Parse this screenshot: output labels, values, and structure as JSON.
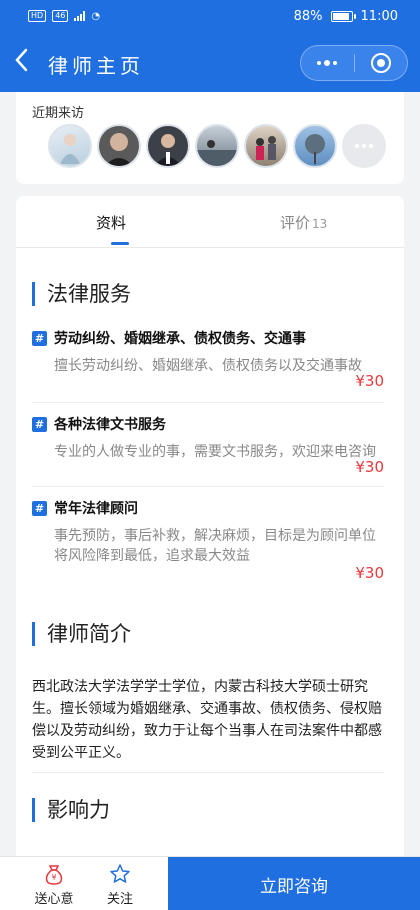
{
  "status_bar": {
    "left_badges": [
      "HD",
      "46"
    ],
    "battery_percent": "88%",
    "time": "11:00"
  },
  "navbar": {
    "back_icon": "chevron-left-icon",
    "title": "律师主页",
    "menu_icon": "more-dots-icon",
    "close_icon": "target-circle-icon"
  },
  "visitors": {
    "label": "近期来访",
    "avatars": [
      {
        "id": "visitor-1",
        "color": "#c9dbe8"
      },
      {
        "id": "visitor-2",
        "color": "#4a4a4a"
      },
      {
        "id": "visitor-3",
        "color": "#2f3338"
      },
      {
        "id": "visitor-4",
        "color": "#8a9aa6"
      },
      {
        "id": "visitor-5",
        "color": "#b7a99a"
      },
      {
        "id": "visitor-6",
        "color": "#7fa6cf"
      }
    ],
    "more_icon": "more-dots-icon"
  },
  "tabs": {
    "info": "资料",
    "reviews": "评价",
    "reviews_count": "13"
  },
  "services": {
    "heading": "法律服务",
    "items": [
      {
        "title": "劳动纠纷、婚姻继承、债权债务、交通事",
        "desc": "擅长劳动纠纷、婚姻继承、债权债务以及交通事故",
        "price": "¥30"
      },
      {
        "title": "各种法律文书服务",
        "desc": "专业的人做专业的事，需要文书服务，欢迎来电咨询",
        "price": "¥30"
      },
      {
        "title": "常年法律顾问",
        "desc": "事先预防，事后补救，解决麻烦，目标是为顾问单位将风险降到最低，追求最大效益",
        "price": "¥30"
      }
    ]
  },
  "profile": {
    "heading": "律师简介",
    "text": "西北政法大学法学学士学位，内蒙古科技大学硕士研究生。擅长领域为婚姻继承、交通事故、债权债务、侵权赔偿以及劳动纠纷，致力于让每个当事人在司法案件中都感受到公平正义。"
  },
  "influence": {
    "heading": "影响力"
  },
  "bottom_bar": {
    "gift_label": "送心意",
    "follow_label": "关注",
    "consult_label": "立即咨询"
  },
  "colors": {
    "primary": "#1f6fe0",
    "price": "#e8383d"
  }
}
